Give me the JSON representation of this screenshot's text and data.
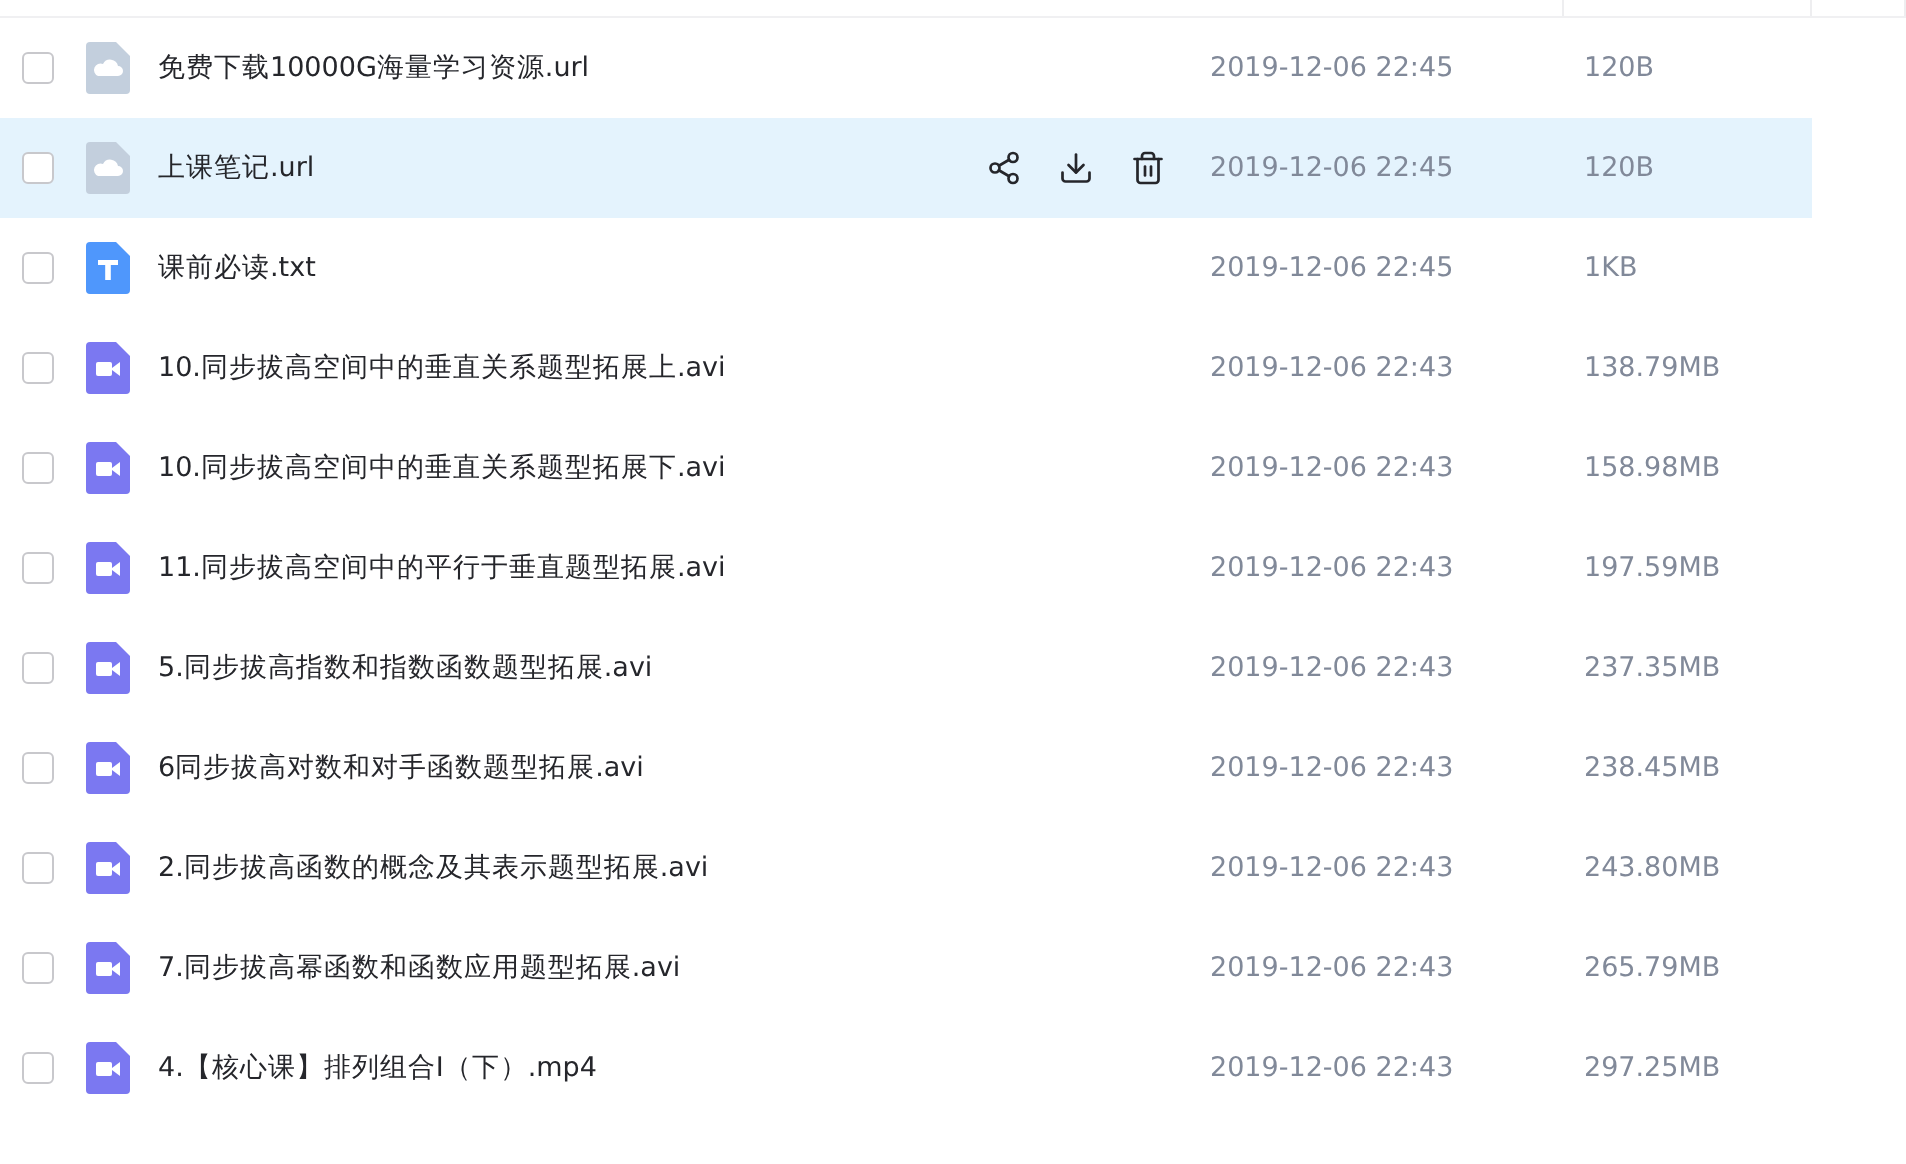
{
  "files": [
    {
      "kind": "url",
      "name": "免费下载10000G海量学习资源.url",
      "modified": "2019-12-06 22:45",
      "size": "120B",
      "checked": false,
      "selected": false
    },
    {
      "kind": "url",
      "name": "上课笔记.url",
      "modified": "2019-12-06 22:45",
      "size": "120B",
      "checked": false,
      "selected": true
    },
    {
      "kind": "txt",
      "name": "课前必读.txt",
      "modified": "2019-12-06 22:45",
      "size": "1KB",
      "checked": false,
      "selected": false
    },
    {
      "kind": "video",
      "name": "10.同步拔高空间中的垂直关系题型拓展上.avi",
      "modified": "2019-12-06 22:43",
      "size": "138.79MB",
      "checked": false,
      "selected": false
    },
    {
      "kind": "video",
      "name": "10.同步拔高空间中的垂直关系题型拓展下.avi",
      "modified": "2019-12-06 22:43",
      "size": "158.98MB",
      "checked": false,
      "selected": false
    },
    {
      "kind": "video",
      "name": "11.同步拔高空间中的平行于垂直题型拓展.avi",
      "modified": "2019-12-06 22:43",
      "size": "197.59MB",
      "checked": false,
      "selected": false
    },
    {
      "kind": "video",
      "name": "5.同步拔高指数和指数函数题型拓展.avi",
      "modified": "2019-12-06 22:43",
      "size": "237.35MB",
      "checked": false,
      "selected": false
    },
    {
      "kind": "video",
      "name": "6同步拔高对数和对手函数题型拓展.avi",
      "modified": "2019-12-06 22:43",
      "size": "238.45MB",
      "checked": false,
      "selected": false
    },
    {
      "kind": "video",
      "name": "2.同步拔高函数的概念及其表示题型拓展.avi",
      "modified": "2019-12-06 22:43",
      "size": "243.80MB",
      "checked": false,
      "selected": false
    },
    {
      "kind": "video",
      "name": "7.同步拔高幂函数和函数应用题型拓展.avi",
      "modified": "2019-12-06 22:43",
      "size": "265.79MB",
      "checked": false,
      "selected": false
    },
    {
      "kind": "video",
      "name": "4.【核心课】排列组合I（下）.mp4",
      "modified": "2019-12-06 22:43",
      "size": "297.25MB",
      "checked": false,
      "selected": false
    }
  ]
}
